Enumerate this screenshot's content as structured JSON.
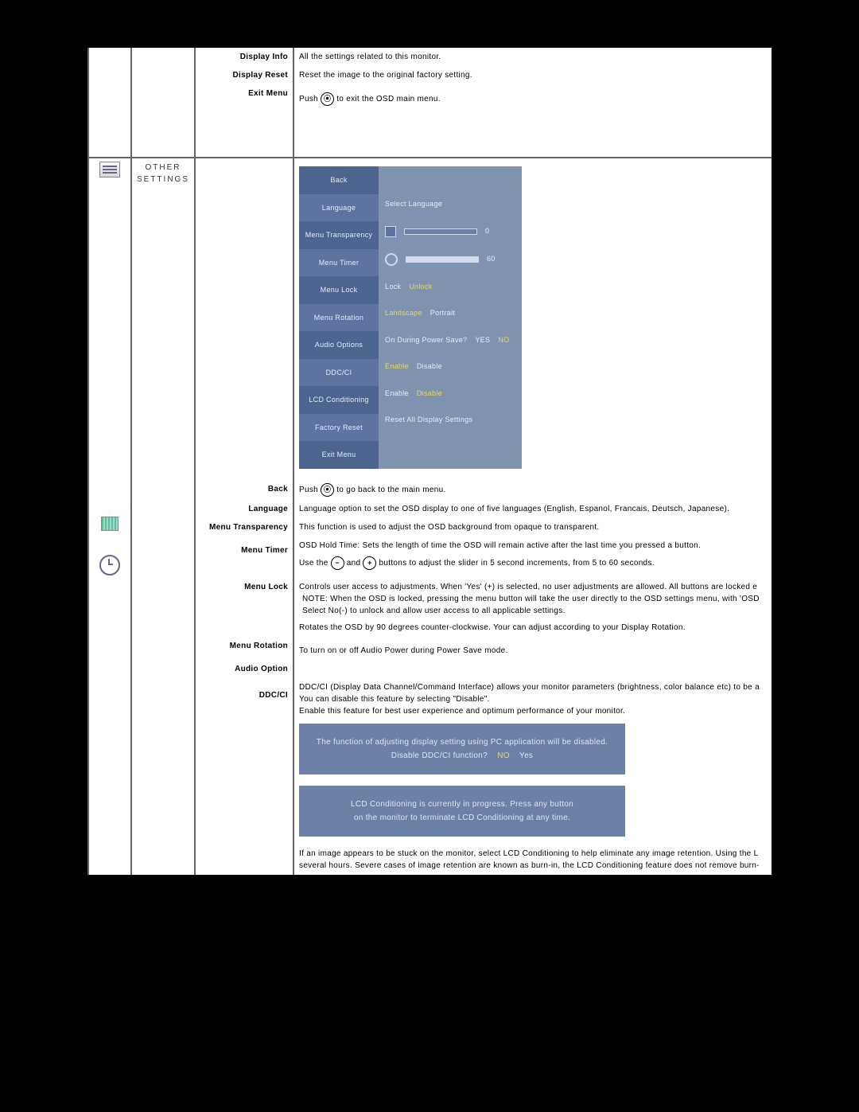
{
  "topRows": {
    "displayInfo": {
      "label": "Display Info",
      "desc": "All the settings related to this monitor."
    },
    "displayReset": {
      "label": "Display Reset",
      "desc": "Reset the image to the original factory setting."
    },
    "exitMenu": {
      "label": "Exit Menu",
      "desc_pre": "Push ",
      "desc_post": " to exit the OSD main menu."
    }
  },
  "sectionTitle": "OTHER SETTINGS",
  "osd": {
    "left": [
      "Back",
      "Language",
      "Menu Transparency",
      "Menu Timer",
      "Menu Lock",
      "Menu Rotation",
      "Audio Options",
      "DDC/CI",
      "LCD Conditioning",
      "Factory Reset",
      "Exit Menu"
    ],
    "right": {
      "language": {
        "label": "Select Language"
      },
      "transparency": {
        "value": "0"
      },
      "timer": {
        "value": "60"
      },
      "lock": {
        "a": "Lock",
        "b": "Unlock"
      },
      "rotation": {
        "a": "Landscape",
        "b": "Portrait"
      },
      "audio": {
        "label": "On During Power Save?",
        "yes": "YES",
        "no": "NO"
      },
      "ddcci": {
        "a": "Enable",
        "b": "Disable"
      },
      "lcdc": {
        "a": "Enable",
        "b": "Disable"
      },
      "factory": {
        "label": "Reset All Display Settings"
      }
    }
  },
  "rows": {
    "back": {
      "label": "Back",
      "desc_pre": "Push ",
      "desc_post": " to go back to the main menu."
    },
    "language": {
      "label": "Language",
      "desc": "Language option to set the OSD display to one of five languages (English, Espanol, Francais, Deutsch, Japanese)."
    },
    "transparency": {
      "label": "Menu Transparency",
      "desc": "This function is used to adjust the OSD background from opaque to transparent."
    },
    "timer": {
      "label": "Menu Timer",
      "line1": "OSD Hold Time: Sets the length of time the OSD will remain active after the last time you pressed a button.",
      "line2_pre": "Use the ",
      "line2_mid": "and ",
      "line2_post": " buttons to adjust the slider in 5 second increments, from 5 to 60 seconds."
    },
    "lock": {
      "label": "Menu Lock",
      "line1": "Controls user access to adjustments. When 'Yes' (+) is selected, no user adjustments are allowed. All buttons are locked e",
      "note": "NOTE: When the OSD is locked, pressing the menu button will take the user directly to the OSD settings menu, with 'OSD Select No(-) to unlock and allow user access to all applicable settings.",
      "line3": "Rotates the OSD by 90 degrees counter-clockwise. Your can adjust according to your Display Rotation."
    },
    "rotation": {
      "label": "Menu Rotation",
      "desc": "To turn on or off Audio Power during Power Save mode."
    },
    "audio": {
      "label": "Audio Option"
    },
    "ddcci": {
      "label": "DDC/CI",
      "line1": "DDC/CI (Display Data Channel/Command Interface) allows your monitor parameters (brightness, color balance etc) to be a",
      "line2": "You can disable this feature by selecting \"Disable\".",
      "line3": "Enable this feature for best user experience and optimum performance of your monitor."
    },
    "lcdc": {
      "line1": "If an image appears to be stuck on the monitor, select LCD Conditioning to help eliminate any image retention. Using the L",
      "line2": "several hours. Severe cases of image retention are known as burn-in, the LCD Conditioning feature does not remove burn-"
    }
  },
  "banner1": {
    "line1": "The function of adjusting display setting using PC application will be disabled.",
    "line2_label": "Disable DDC/CI function?",
    "no": "NO",
    "yes": "Yes"
  },
  "banner2": {
    "line1": "LCD Conditioning is currently in progress. Press any button",
    "line2": "on the monitor to terminate LCD Conditioning at any time."
  }
}
